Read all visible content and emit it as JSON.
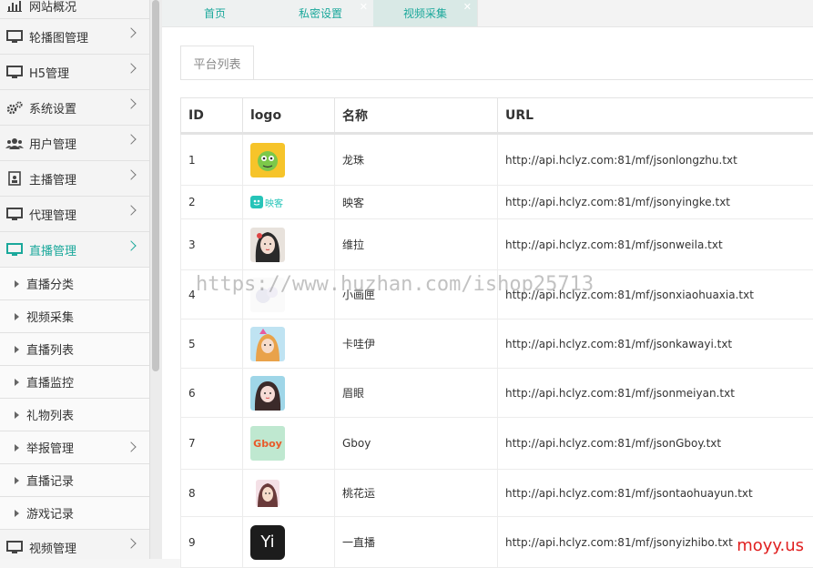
{
  "sidebar": {
    "items": [
      {
        "label": "网站概况",
        "icon": "bar-chart-icon",
        "chev": false
      },
      {
        "label": "轮播图管理",
        "icon": "monitor-icon",
        "chev": true
      },
      {
        "label": "H5管理",
        "icon": "monitor-icon",
        "chev": true
      },
      {
        "label": "系统设置",
        "icon": "gears-icon",
        "chev": true
      },
      {
        "label": "用户管理",
        "icon": "users-icon",
        "chev": true
      },
      {
        "label": "主播管理",
        "icon": "id-card-icon",
        "chev": true
      },
      {
        "label": "代理管理",
        "icon": "monitor-icon",
        "chev": true
      },
      {
        "label": "直播管理",
        "icon": "monitor-icon",
        "chev": true,
        "active": true
      }
    ],
    "sub_items": [
      {
        "label": "直播分类",
        "chev": false
      },
      {
        "label": "视频采集",
        "chev": false
      },
      {
        "label": "直播列表",
        "chev": false
      },
      {
        "label": "直播监控",
        "chev": false
      },
      {
        "label": "礼物列表",
        "chev": false
      },
      {
        "label": "举报管理",
        "chev": true
      },
      {
        "label": "直播记录",
        "chev": false
      },
      {
        "label": "游戏记录",
        "chev": false
      }
    ],
    "last_item": {
      "label": "视频管理"
    }
  },
  "tabs": [
    {
      "label": "首页",
      "closable": false
    },
    {
      "label": "私密设置",
      "closable": true
    },
    {
      "label": "视频采集",
      "closable": true,
      "active": true
    }
  ],
  "panel_tab": "平台列表",
  "table": {
    "headers": [
      "ID",
      "logo",
      "名称",
      "URL"
    ],
    "rows": [
      {
        "id": "1",
        "name": "龙珠",
        "url": "http://api.hclyz.com:81/mf/jsonlongzhu.txt"
      },
      {
        "id": "2",
        "name": "映客",
        "url": "http://api.hclyz.com:81/mf/jsonyingke.txt",
        "logo_text": "映客"
      },
      {
        "id": "3",
        "name": "维拉",
        "url": "http://api.hclyz.com:81/mf/jsonweila.txt"
      },
      {
        "id": "4",
        "name": "小画匣",
        "url": "http://api.hclyz.com:81/mf/jsonxiaohuaxia.txt"
      },
      {
        "id": "5",
        "name": "卡哇伊",
        "url": "http://api.hclyz.com:81/mf/jsonkawayi.txt"
      },
      {
        "id": "6",
        "name": "眉眼",
        "url": "http://api.hclyz.com:81/mf/jsonmeiyan.txt"
      },
      {
        "id": "7",
        "name": "Gboy",
        "url": "http://api.hclyz.com:81/mf/jsonGboy.txt",
        "logo_text": "Gboy"
      },
      {
        "id": "8",
        "name": "桃花运",
        "url": "http://api.hclyz.com:81/mf/jsontaohuayun.txt"
      },
      {
        "id": "9",
        "name": "一直播",
        "url": "http://api.hclyz.com:81/mf/jsonyizhibo.txt",
        "logo_text": "Yi"
      }
    ]
  },
  "watermark": "https://www.huzhan.com/ishop25713",
  "corner_mark": "moyy.us",
  "colors": {
    "accent": "#1aa89b",
    "corner": "#e02020"
  }
}
